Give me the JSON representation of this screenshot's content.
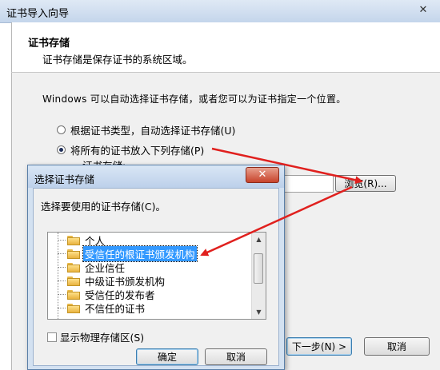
{
  "wizard": {
    "title": "证书导入向导",
    "close_glyph": "✕",
    "heading": "证书存储",
    "subheading": "证书存储是保存证书的系统区域。",
    "description": "Windows 可以自动选择证书存储，或者您可以为证书指定一个位置。",
    "radio_auto": "根据证书类型，自动选择证书存储(U)",
    "radio_manual": "将所有的证书放入下列存储(P)",
    "store_label": "证书存储:",
    "browse_label": "浏览(R)...",
    "next_label": "下一步(N) >",
    "cancel_label": "取消"
  },
  "dialog": {
    "title": "选择证书存储",
    "close_glyph": "✕",
    "prompt": "选择要使用的证书存储(C)。",
    "tree_items": [
      {
        "label": "个人",
        "selected": false
      },
      {
        "label": "受信任的根证书颁发机构",
        "selected": true
      },
      {
        "label": "企业信任",
        "selected": false
      },
      {
        "label": "中级证书颁发机构",
        "selected": false
      },
      {
        "label": "受信任的发布者",
        "selected": false
      },
      {
        "label": "不信任的证书",
        "selected": false
      }
    ],
    "show_physical_label": "显示物理存储区(S)",
    "ok_label": "确定",
    "cancel_label": "取消"
  },
  "colors": {
    "arrow": "#e0201e",
    "selection": "#3399ff"
  }
}
